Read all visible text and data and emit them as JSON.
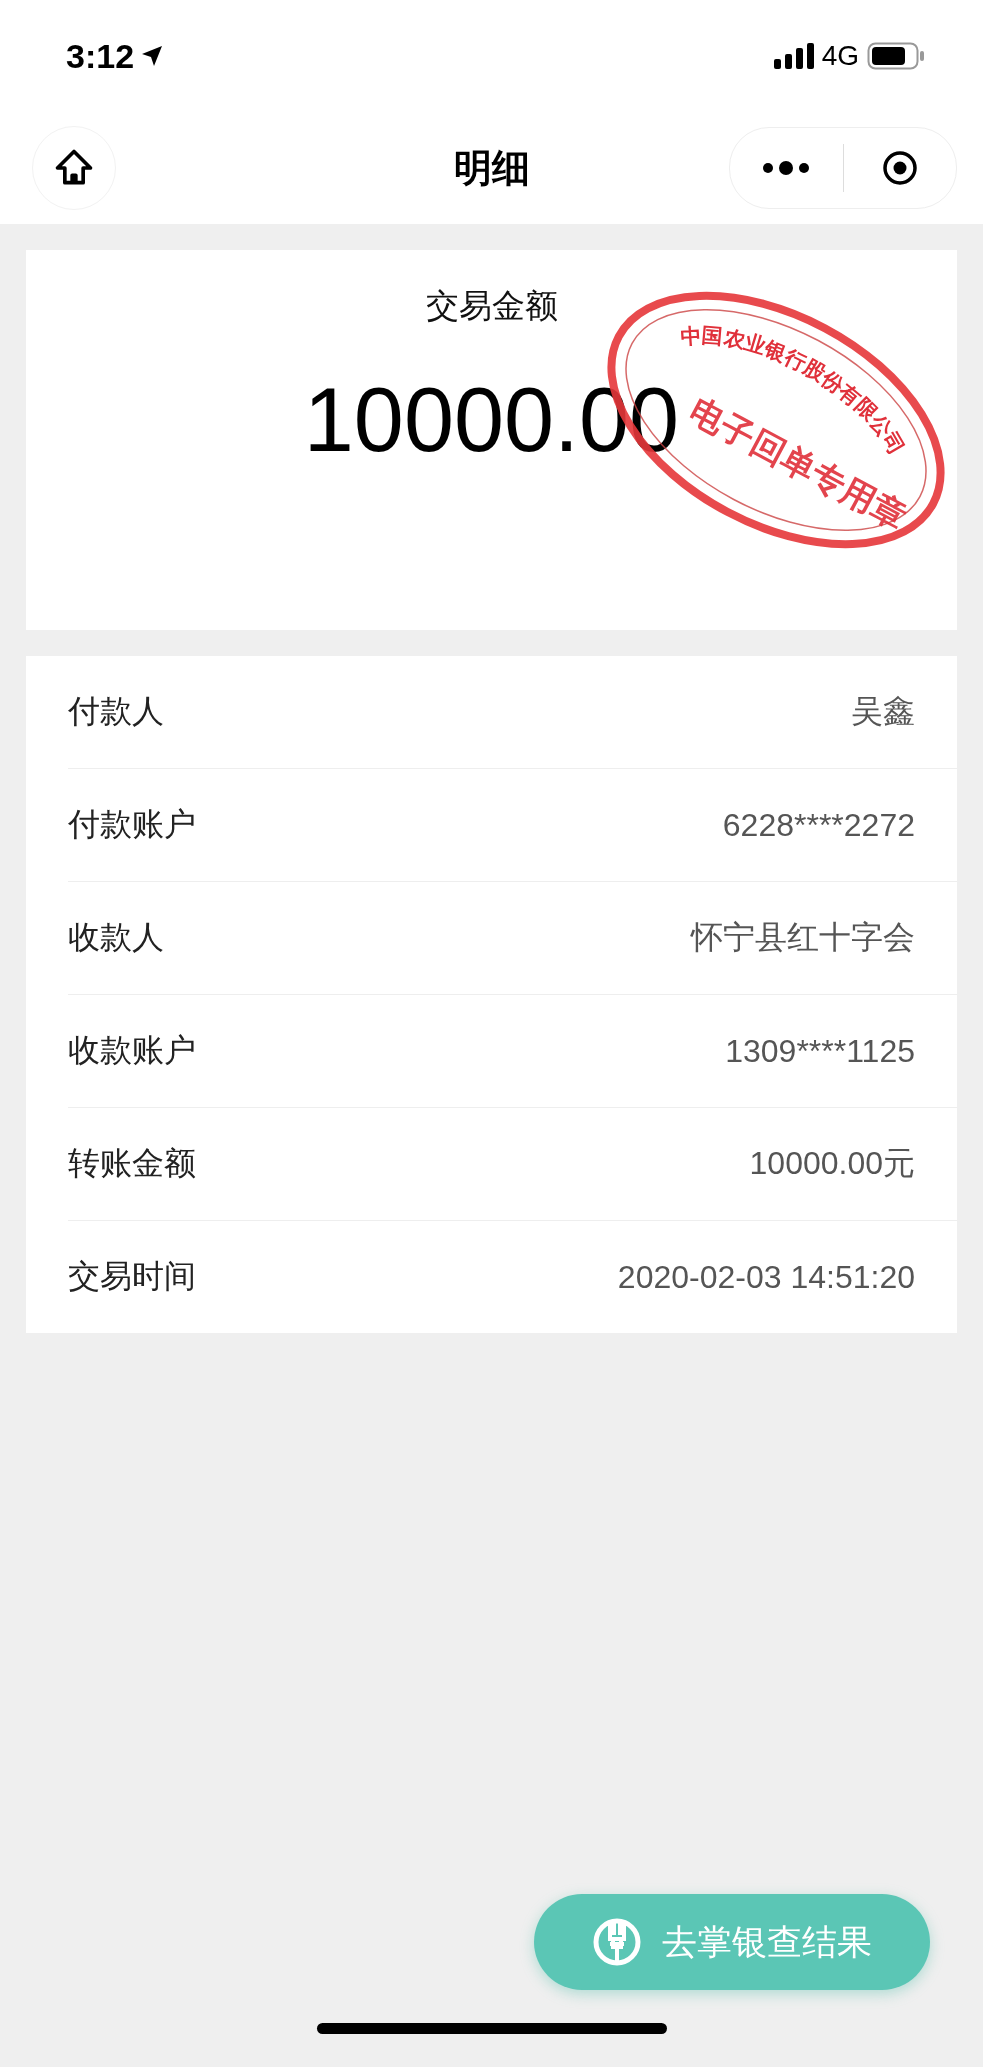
{
  "status_bar": {
    "time": "3:12",
    "network": "4G"
  },
  "nav": {
    "title": "明细"
  },
  "summary": {
    "label": "交易金额",
    "amount": "10000.00"
  },
  "stamp": {
    "top_text": "中国农业银行股份有限公司",
    "center_text": "电子回单专用章"
  },
  "details": [
    {
      "label": "付款人",
      "value": "吴鑫"
    },
    {
      "label": "付款账户",
      "value": "6228****2272"
    },
    {
      "label": "收款人",
      "value": "怀宁县红十字会"
    },
    {
      "label": "收款账户",
      "value": "1309****1125"
    },
    {
      "label": "转账金额",
      "value": "10000.00元"
    },
    {
      "label": "交易时间",
      "value": "2020-02-03 14:51:20"
    }
  ],
  "action_button": {
    "label": "去掌银查结果"
  }
}
